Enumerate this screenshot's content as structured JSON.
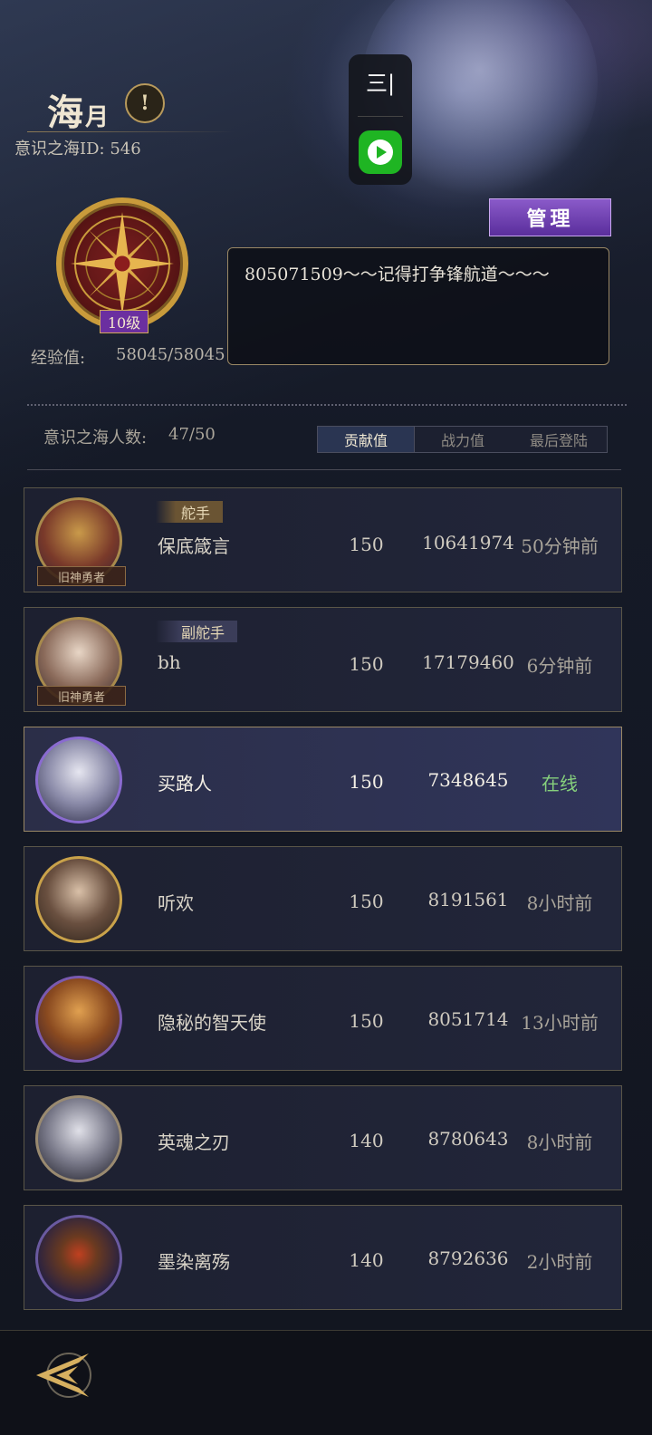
{
  "header": {
    "guild_name_main": "海",
    "guild_name_small": "月",
    "guild_id_label": "意识之海ID:",
    "guild_id_value": "546",
    "warning_glyph": "!"
  },
  "overlay": {
    "logo_text": "三|",
    "icons": [
      "app-logo-icon",
      "play-icon"
    ]
  },
  "manage_button_label": "管理",
  "emblem": {
    "level": "10级",
    "exp_label": "经验值:",
    "exp_value": "58045/58045"
  },
  "notice_text": "805071509～～记得打争锋航道～～～",
  "members_summary": {
    "label": "意识之海人数:",
    "value": "47/50"
  },
  "sort_tabs": [
    {
      "label": "贡献值",
      "active": true
    },
    {
      "label": "战力值",
      "active": false
    },
    {
      "label": "最后登陆",
      "active": false
    }
  ],
  "members": [
    {
      "name": "保底箴言",
      "role": "舵手",
      "avatar_tag": "旧神勇者",
      "contribution": "150",
      "power": "10641974",
      "last_login": "50分钟前",
      "online": false,
      "self": false
    },
    {
      "name": "bh",
      "role": "副舵手",
      "avatar_tag": "旧神勇者",
      "contribution": "150",
      "power": "17179460",
      "last_login": "6分钟前",
      "online": false,
      "self": false
    },
    {
      "name": "买路人",
      "role": "",
      "avatar_tag": "",
      "contribution": "150",
      "power": "7348645",
      "last_login": "在线",
      "online": true,
      "self": true
    },
    {
      "name": "听欢",
      "role": "",
      "avatar_tag": "",
      "contribution": "150",
      "power": "8191561",
      "last_login": "8小时前",
      "online": false,
      "self": false
    },
    {
      "name": "隐秘的智天使",
      "role": "",
      "avatar_tag": "",
      "contribution": "150",
      "power": "8051714",
      "last_login": "13小时前",
      "online": false,
      "self": false
    },
    {
      "name": "英魂之刃",
      "role": "",
      "avatar_tag": "",
      "contribution": "140",
      "power": "8780643",
      "last_login": "8小时前",
      "online": false,
      "self": false
    },
    {
      "name": "墨染离殇",
      "role": "",
      "avatar_tag": "",
      "contribution": "140",
      "power": "8792636",
      "last_login": "2小时前",
      "online": false,
      "self": false
    }
  ],
  "colors": {
    "accent_gold": "#c99b3b",
    "manage_purple": "#6a3ab0",
    "online_green": "#86d07c",
    "play_green": "#1fb523"
  }
}
